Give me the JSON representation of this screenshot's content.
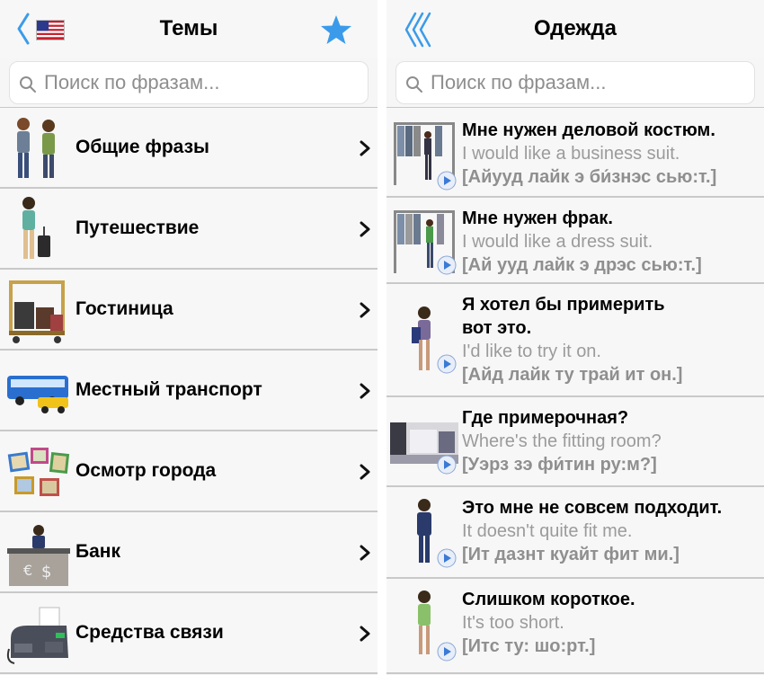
{
  "left_panel": {
    "title": "Темы",
    "search_placeholder": "Поиск по фразам...",
    "topics": [
      {
        "label": "Общие фразы",
        "icon": "people-talking-icon"
      },
      {
        "label": "Путешествие",
        "icon": "traveler-suitcase-icon"
      },
      {
        "label": "Гостиница",
        "icon": "luggage-cart-icon"
      },
      {
        "label": "Местный транспорт",
        "icon": "bus-taxi-icon"
      },
      {
        "label": "Осмотр города",
        "icon": "photo-frames-icon"
      },
      {
        "label": "Банк",
        "icon": "bank-counter-icon"
      },
      {
        "label": "Средства связи",
        "icon": "fax-machine-icon"
      }
    ]
  },
  "right_panel": {
    "title": "Одежда",
    "search_placeholder": "Поиск по фразам...",
    "phrases": [
      {
        "ru": "Мне нужен деловой костюм.",
        "en": "I would like a business suit.",
        "tr": "[Айууд лайк э би́знэс сью:т.]"
      },
      {
        "ru": "Мне нужен фрак.",
        "en": "I would like a dress suit.",
        "tr": "[Ай ууд лайк э дрэс сью:т.]"
      },
      {
        "ru": "Я хотел бы примерить",
        "ru2": "вот это.",
        "en": "I'd like to try it on.",
        "tr": "[Айд лайк ту трай ит он.]"
      },
      {
        "ru": "Где примерочная?",
        "en": "Where's the fitting room?",
        "tr": "[Уэрз зэ фи́тин ру:м?]"
      },
      {
        "ru": "Это мне не совсем подходит.",
        "en": "It doesn't quite fit me.",
        "tr": "[Ит дазнт куайт фит ми.]"
      },
      {
        "ru": "Слишком короткое.",
        "en": "It's too short.",
        "tr": "[Итс ту: шо:рт.]"
      }
    ]
  },
  "colors": {
    "accent": "#3b9bea",
    "divider": "#c9c9c9",
    "secondary_text": "#9b9b9b"
  }
}
